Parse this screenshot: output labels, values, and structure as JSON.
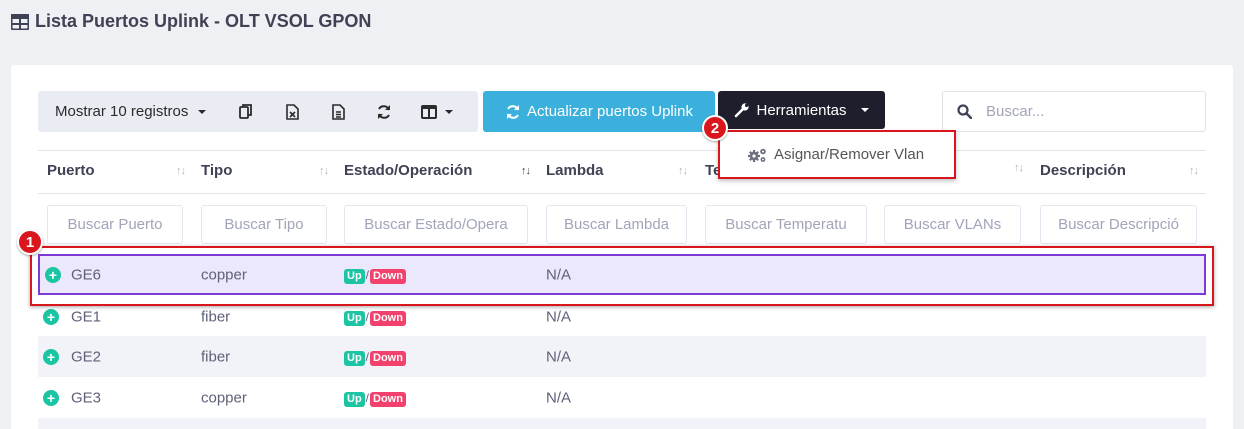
{
  "page": {
    "title": "Lista Puertos Uplink - OLT VSOL GPON"
  },
  "toolbar": {
    "show_label": "Mostrar 10 registros",
    "icons": [
      "copy-icon",
      "excel-icon",
      "csv-icon",
      "refresh-icon",
      "columns-icon"
    ]
  },
  "actions": {
    "update_label": "Actualizar puertos Uplink",
    "tools_label": "Herramientas",
    "dropdown_item": "Asignar/Remover Vlan"
  },
  "search": {
    "placeholder": "Buscar..."
  },
  "callouts": {
    "one": "1",
    "two": "2"
  },
  "table": {
    "headers": [
      "Puerto",
      "Tipo",
      "Estado/Operación",
      "Lambda",
      "Te",
      "",
      "Descripción"
    ],
    "filters": [
      "Buscar Puerto",
      "Buscar Tipo",
      "Buscar Estado/Opera",
      "Buscar Lambda",
      "Buscar Temperatu",
      "Buscar VLANs",
      "Buscar Descripció"
    ],
    "rows": [
      {
        "puerto": "GE6",
        "tipo": "copper",
        "up": "Up",
        "sep": "/",
        "down": "Down",
        "lambda": "N/A"
      },
      {
        "puerto": "GE1",
        "tipo": "fiber",
        "up": "Up",
        "sep": "/",
        "down": "Down",
        "lambda": "N/A"
      },
      {
        "puerto": "GE2",
        "tipo": "fiber",
        "up": "Up",
        "sep": "/",
        "down": "Down",
        "lambda": "N/A"
      },
      {
        "puerto": "GE3",
        "tipo": "copper",
        "up": "Up",
        "sep": "/",
        "down": "Down",
        "lambda": "N/A"
      }
    ]
  },
  "colors": {
    "accent": "#3bb0dc",
    "dark": "#1e1e2d",
    "annotation": "#d9161c",
    "up": "#1bc5a3",
    "down": "#f1416c",
    "selected": "#7c39d6"
  }
}
